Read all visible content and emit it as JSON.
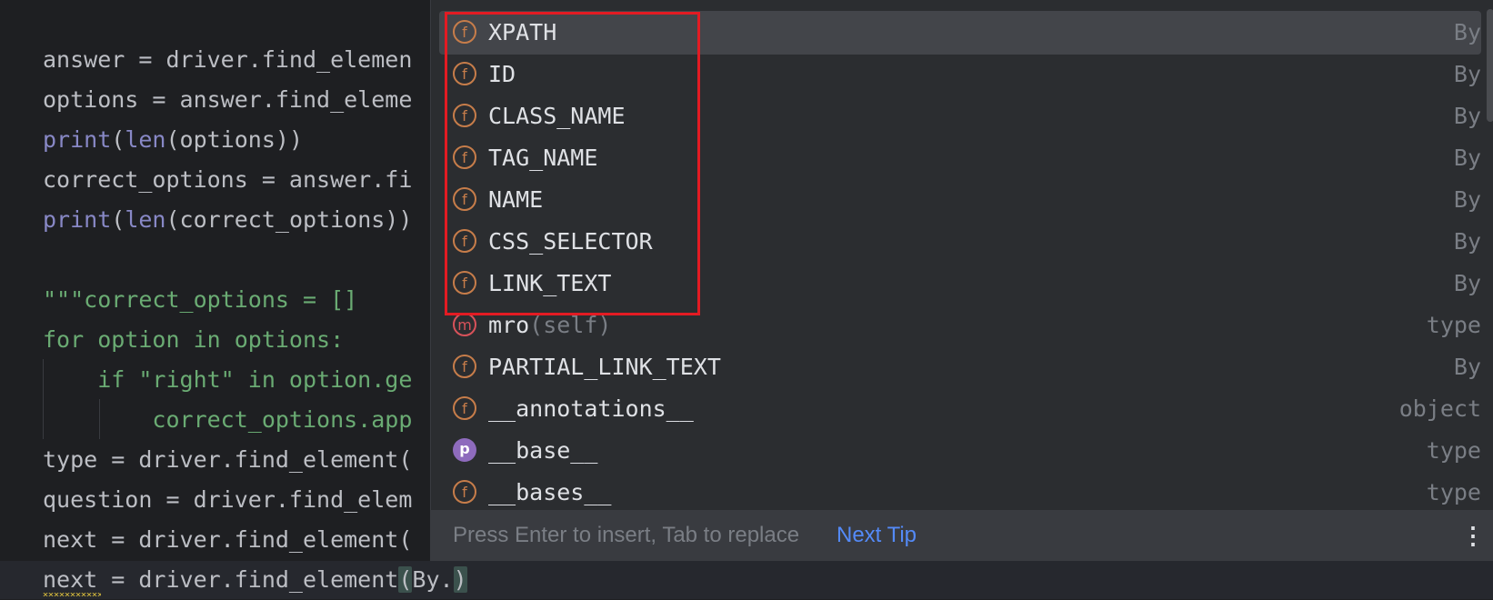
{
  "editor": {
    "lines": [
      {
        "parts": [
          {
            "t": "answer = driver.find_elemen"
          }
        ]
      },
      {
        "parts": [
          {
            "t": "options = answer.find_eleme"
          }
        ]
      },
      {
        "parts": [
          {
            "t": "print",
            "c": "kw-func"
          },
          {
            "t": "("
          },
          {
            "t": "len",
            "c": "kw-func"
          },
          {
            "t": "(options))"
          }
        ]
      },
      {
        "parts": [
          {
            "t": "correct_options = answer.fi"
          }
        ]
      },
      {
        "parts": [
          {
            "t": "print",
            "c": "kw-func"
          },
          {
            "t": "("
          },
          {
            "t": "len",
            "c": "kw-func"
          },
          {
            "t": "(correct_options))"
          }
        ]
      },
      {
        "parts": [
          {
            "t": ""
          }
        ]
      },
      {
        "parts": [
          {
            "t": "\"\"\"correct_options = []",
            "c": "str"
          }
        ]
      },
      {
        "parts": [
          {
            "t": "for option in options:",
            "c": "str"
          }
        ]
      },
      {
        "parts": [
          {
            "t": "    if \"right\" in option.ge",
            "c": "str"
          }
        ]
      },
      {
        "parts": [
          {
            "t": "        correct_options.app",
            "c": "str"
          }
        ]
      },
      {
        "parts": [
          {
            "t": "type = driver.find_element("
          }
        ]
      },
      {
        "parts": [
          {
            "t": "question = driver.find_elem"
          }
        ]
      },
      {
        "parts": [
          {
            "t": "next = driver.find_element("
          }
        ]
      },
      {
        "parts": [
          {
            "t": "next = driver.find_element"
          },
          {
            "t": "(",
            "c": "paren-hl"
          },
          {
            "t": "By."
          },
          {
            "t": ")",
            "c": "paren-hl"
          }
        ]
      }
    ]
  },
  "completion": {
    "items": [
      {
        "icon": "field-icon",
        "glyph": "f",
        "kind": "field",
        "name": "XPATH",
        "type": "By",
        "selected": true
      },
      {
        "icon": "field-icon",
        "glyph": "f",
        "kind": "field",
        "name": "ID",
        "type": "By"
      },
      {
        "icon": "field-icon",
        "glyph": "f",
        "kind": "field",
        "name": "CLASS_NAME",
        "type": "By"
      },
      {
        "icon": "field-icon",
        "glyph": "f",
        "kind": "field",
        "name": "TAG_NAME",
        "type": "By"
      },
      {
        "icon": "field-icon",
        "glyph": "f",
        "kind": "field",
        "name": "NAME",
        "type": "By"
      },
      {
        "icon": "field-icon",
        "glyph": "f",
        "kind": "field",
        "name": "CSS_SELECTOR",
        "type": "By"
      },
      {
        "icon": "field-icon",
        "glyph": "f",
        "kind": "field",
        "name": "LINK_TEXT",
        "type": "By"
      },
      {
        "icon": "method-icon",
        "glyph": "m",
        "kind": "method",
        "name": "mro",
        "params": "(self)",
        "type": "type"
      },
      {
        "icon": "field-icon",
        "glyph": "f",
        "kind": "field",
        "name": "PARTIAL_LINK_TEXT",
        "type": "By"
      },
      {
        "icon": "field-icon",
        "glyph": "f",
        "kind": "field",
        "name": "__annotations__",
        "type": "object"
      },
      {
        "icon": "property-icon",
        "glyph": "p",
        "kind": "prop",
        "name": "__base__",
        "type": "type"
      },
      {
        "icon": "field-icon",
        "glyph": "f",
        "kind": "field",
        "name": "__bases__",
        "type": "type"
      }
    ],
    "footer": {
      "hint": "Press Enter to insert, Tab to replace",
      "next_tip": "Next Tip",
      "more": "⋮"
    }
  }
}
